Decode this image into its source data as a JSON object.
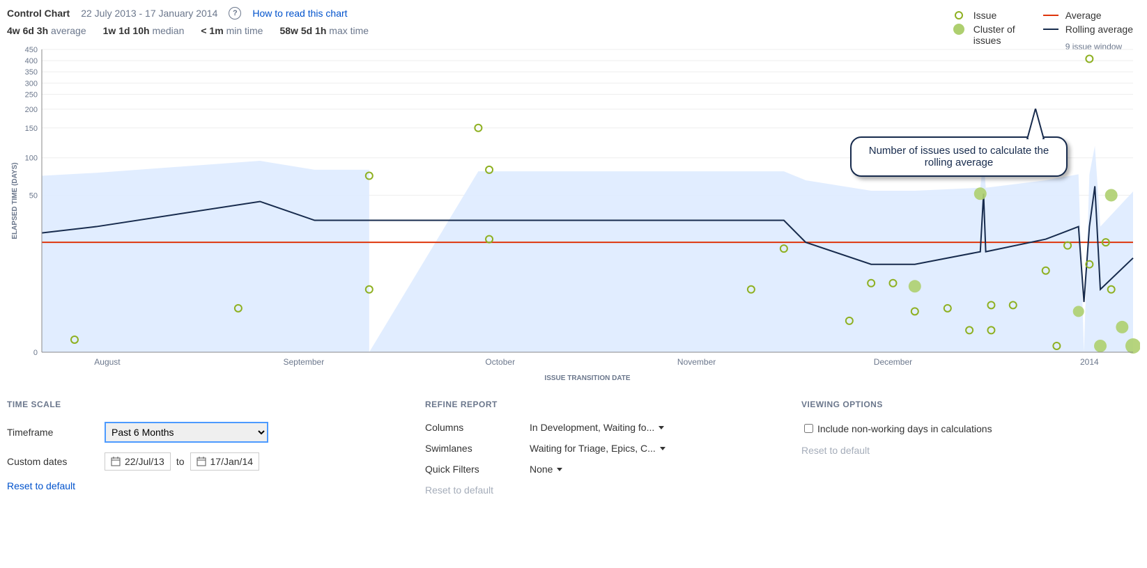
{
  "header": {
    "title": "Control Chart",
    "date_range": "22 July 2013 - 17 January 2014",
    "help_link": "How to read this chart"
  },
  "stats": {
    "average": {
      "value": "4w 6d 3h",
      "label": "average"
    },
    "median": {
      "value": "1w 1d 10h",
      "label": "median"
    },
    "min": {
      "value": "< 1m",
      "label": "min time"
    },
    "max": {
      "value": "58w 5d 1h",
      "label": "max time"
    }
  },
  "legend": {
    "issue": "Issue",
    "cluster": "Cluster of\nissues",
    "average": "Average",
    "rolling": "Rolling average",
    "rolling_sub": "9 issue window"
  },
  "callout": "Number of issues used to calculate the rolling average",
  "chart_data": {
    "type": "control",
    "xlabel": "ISSUE TRANSITION DATE",
    "ylabel": "ELAPSED TIME (DAYS)",
    "x_categories": [
      "August",
      "September",
      "October",
      "November",
      "December",
      "2014"
    ],
    "y_ticks": [
      0,
      50,
      100,
      150,
      200,
      250,
      300,
      350,
      400,
      450
    ],
    "ylim": [
      0,
      450
    ],
    "average_y": 35,
    "rolling_average": {
      "x": [
        0.0,
        0.05,
        0.2,
        0.25,
        0.3,
        0.4,
        0.68,
        0.7,
        0.76,
        0.8,
        0.86,
        0.863,
        0.865,
        0.92,
        0.95,
        0.955,
        0.96,
        0.965,
        0.97,
        1.0
      ],
      "y": [
        38,
        40,
        48,
        42,
        42,
        42,
        42,
        35,
        28,
        28,
        32,
        52,
        32,
        36,
        40,
        16,
        40,
        62,
        20,
        30
      ]
    },
    "std_band": {
      "x": [
        0.0,
        0.05,
        0.2,
        0.25,
        0.3,
        0.3,
        0.4,
        0.68,
        0.7,
        0.76,
        0.8,
        0.86,
        0.863,
        0.865,
        0.92,
        0.95,
        0.955,
        0.96,
        0.965,
        0.97,
        1.0
      ],
      "upper": [
        76,
        80,
        96,
        84,
        84,
        0,
        82,
        82,
        70,
        56,
        56,
        60,
        100,
        60,
        70,
        78,
        0,
        78,
        120,
        40,
        55
      ],
      "lower": [
        0,
        0,
        0,
        0,
        0,
        0,
        0,
        0,
        0,
        0,
        0,
        0,
        0,
        0,
        0,
        0,
        0,
        0,
        0,
        0,
        0
      ]
    },
    "issues": [
      {
        "x": 0.03,
        "y": 4,
        "cluster": false
      },
      {
        "x": 0.18,
        "y": 14,
        "cluster": false
      },
      {
        "x": 0.3,
        "y": 76,
        "cluster": false
      },
      {
        "x": 0.3,
        "y": 20,
        "cluster": false
      },
      {
        "x": 0.4,
        "y": 150,
        "cluster": false
      },
      {
        "x": 0.41,
        "y": 84,
        "cluster": false
      },
      {
        "x": 0.41,
        "y": 36,
        "cluster": false
      },
      {
        "x": 0.65,
        "y": 20,
        "cluster": false
      },
      {
        "x": 0.68,
        "y": 33,
        "cluster": false
      },
      {
        "x": 0.74,
        "y": 10,
        "cluster": false
      },
      {
        "x": 0.76,
        "y": 22,
        "cluster": false
      },
      {
        "x": 0.78,
        "y": 22,
        "cluster": false
      },
      {
        "x": 0.8,
        "y": 13,
        "cluster": false
      },
      {
        "x": 0.8,
        "y": 21,
        "cluster": true,
        "size": 9
      },
      {
        "x": 0.83,
        "y": 14,
        "cluster": false
      },
      {
        "x": 0.85,
        "y": 7,
        "cluster": false
      },
      {
        "x": 0.86,
        "y": 52,
        "cluster": true,
        "size": 9
      },
      {
        "x": 0.87,
        "y": 15,
        "cluster": false
      },
      {
        "x": 0.87,
        "y": 7,
        "cluster": false
      },
      {
        "x": 0.89,
        "y": 15,
        "cluster": false
      },
      {
        "x": 0.92,
        "y": 26,
        "cluster": false
      },
      {
        "x": 0.93,
        "y": 2,
        "cluster": false
      },
      {
        "x": 0.94,
        "y": 34,
        "cluster": false
      },
      {
        "x": 0.95,
        "y": 13,
        "cluster": true,
        "size": 8
      },
      {
        "x": 0.96,
        "y": 28,
        "cluster": false
      },
      {
        "x": 0.96,
        "y": 408,
        "cluster": false
      },
      {
        "x": 0.97,
        "y": 2,
        "cluster": true,
        "size": 9
      },
      {
        "x": 0.975,
        "y": 35,
        "cluster": false
      },
      {
        "x": 0.98,
        "y": 50,
        "cluster": true,
        "size": 9
      },
      {
        "x": 0.98,
        "y": 20,
        "cluster": false
      },
      {
        "x": 0.99,
        "y": 8,
        "cluster": true,
        "size": 9
      },
      {
        "x": 1.0,
        "y": 2,
        "cluster": true,
        "size": 11
      }
    ]
  },
  "controls": {
    "time_scale": {
      "title": "TIME SCALE",
      "timeframe_label": "Timeframe",
      "timeframe_value": "Past 6 Months",
      "custom_label": "Custom dates",
      "from": "22/Jul/13",
      "to_label": "to",
      "to": "17/Jan/14",
      "reset": "Reset to default"
    },
    "refine": {
      "title": "REFINE REPORT",
      "columns_label": "Columns",
      "columns_value": "In Development, Waiting fo...",
      "swimlanes_label": "Swimlanes",
      "swimlanes_value": "Waiting for Triage, Epics, C...",
      "quick_label": "Quick Filters",
      "quick_value": "None",
      "reset": "Reset to default"
    },
    "viewing": {
      "title": "VIEWING OPTIONS",
      "include_label": "Include non-working days in calculations",
      "reset": "Reset to default"
    }
  }
}
